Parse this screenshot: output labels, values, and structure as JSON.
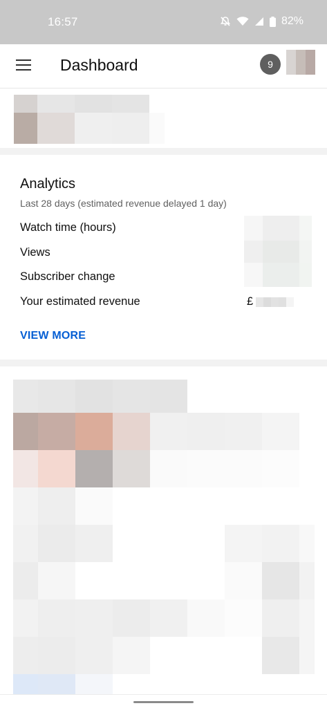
{
  "status_bar": {
    "time": "16:57",
    "battery_percent": "82%",
    "icons": [
      "do-not-disturb-icon",
      "wifi-icon",
      "signal-icon",
      "battery-icon"
    ]
  },
  "app_bar": {
    "title": "Dashboard",
    "notification_count": "9",
    "menu_icon": "hamburger-menu-icon"
  },
  "analytics": {
    "title": "Analytics",
    "subtitle": "Last 28 days (estimated revenue delayed 1 day)",
    "metrics": [
      {
        "label": "Watch time (hours)"
      },
      {
        "label": "Views"
      },
      {
        "label": "Subscriber change"
      },
      {
        "label": "Your estimated revenue",
        "currency": "£"
      }
    ],
    "view_more_label": "VIEW MORE"
  },
  "colors": {
    "accent_link": "#065fd4",
    "status_bar_bg": "#c8c8c8",
    "badge_bg": "#5f5f5f",
    "divider": "#f2f2f2"
  }
}
